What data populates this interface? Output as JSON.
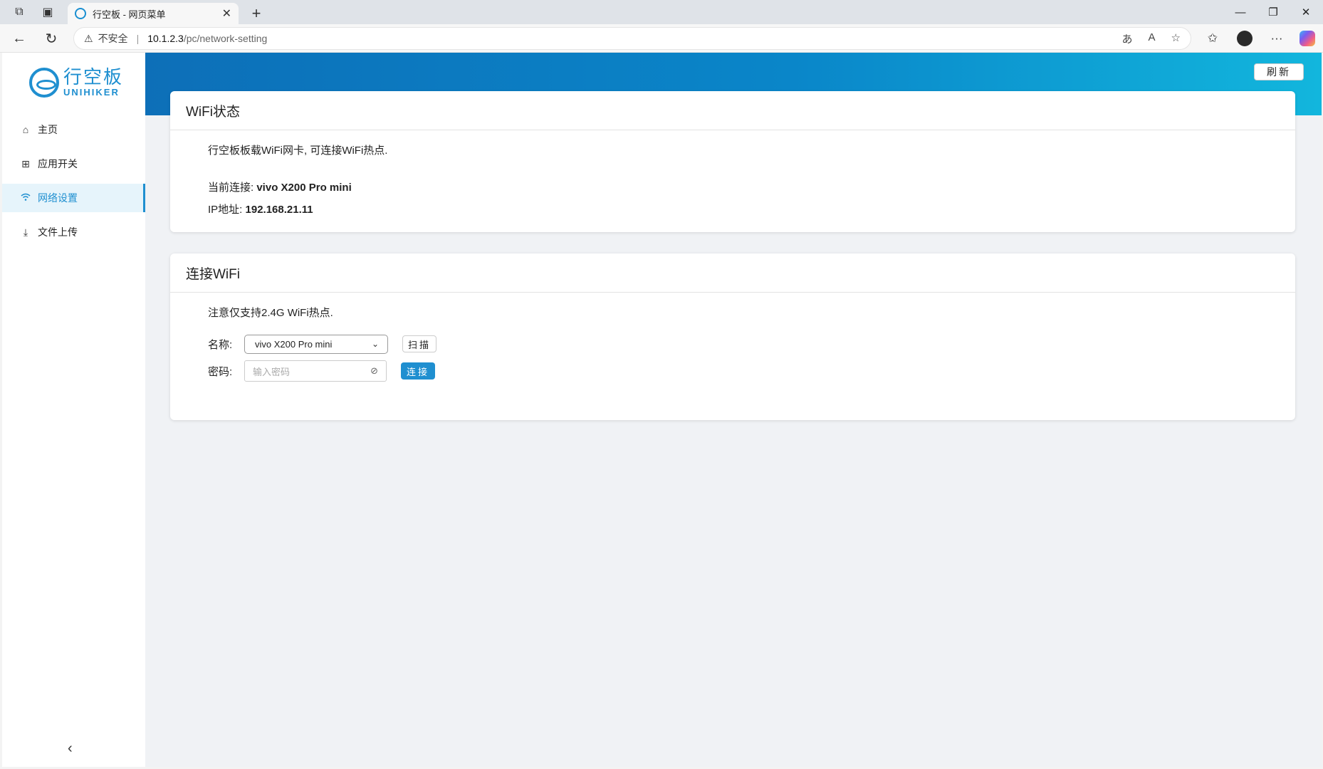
{
  "browser": {
    "tab_title": "行空板 - 网页菜单",
    "security_label": "不安全",
    "url_host": "10.1.2.3",
    "url_path": "/pc/network-setting"
  },
  "sidebar": {
    "logo_cn": "行空板",
    "logo_en": "UNIHIKER",
    "items": [
      {
        "label": "主页",
        "icon": "home-icon"
      },
      {
        "label": "应用开关",
        "icon": "grid-icon"
      },
      {
        "label": "网络设置",
        "icon": "wifi-icon",
        "active": true
      },
      {
        "label": "文件上传",
        "icon": "upload-icon"
      }
    ]
  },
  "header": {
    "refresh_label": "刷新"
  },
  "wifi_status": {
    "title": "WiFi状态",
    "description": "行空板板载WiFi网卡, 可连接WiFi热点.",
    "current_label": "当前连接: ",
    "current_value": "vivo X200 Pro mini",
    "ip_label": "IP地址: ",
    "ip_value": "192.168.21.11"
  },
  "connect_wifi": {
    "title": "连接WiFi",
    "note": "注意仅支持2.4G WiFi热点.",
    "name_label": "名称:",
    "selected_ssid": "vivo X200 Pro mini",
    "scan_label": "扫描",
    "password_label": "密码:",
    "password_placeholder": "输入密码",
    "connect_label": "连接"
  },
  "colors": {
    "accent": "#1f8fd0",
    "active_bg": "#e6f4fb"
  }
}
